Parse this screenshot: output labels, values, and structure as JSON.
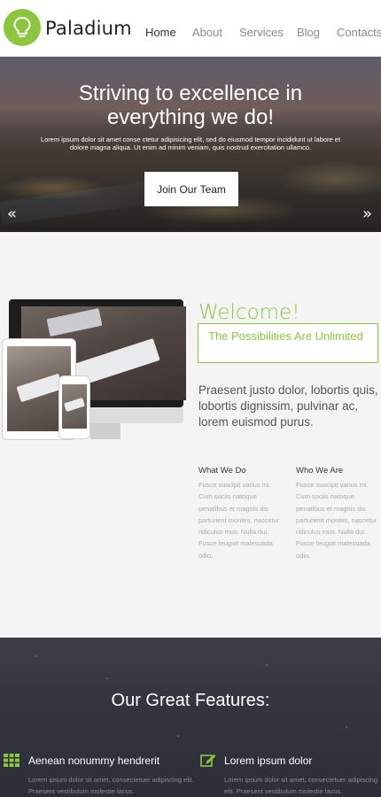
{
  "header": {
    "brand": "Paladium",
    "nav": [
      "Home",
      "About",
      "Services",
      "Blog",
      "Contacts"
    ],
    "active_nav": "Home",
    "icons": {
      "logo": "lightbulb-icon"
    }
  },
  "hero": {
    "title_line1": "Striving to excellence in",
    "title_line2": "everything we do!",
    "text": "Lorem ipsum dolor sit amet conse ctetur adipisicing elit, sed do eiusmod tempor incididunt ut labore et dolore magna aliqua. Ut enim ad minim veniam, quis nostrud exercitation ullamco.",
    "button": "Join Our Team",
    "prev_arrow": "«",
    "next_arrow": "»"
  },
  "welcome": {
    "heading": "Welcome!",
    "tagline": "The Possibilities Are Unlimited",
    "intro": "Praesent justo dolor, lobortis quis, lobortis dignissim, pulvinar ac, lorem euismod purus.",
    "columns": [
      {
        "title": "What We Do",
        "text": "Fusce suscipit varius mi. Cum sociis natoque penatibus et magnis dis parturient montes, nascetur ridiculus mus. Nulla dui. Fusce feugiat malesuada odio."
      },
      {
        "title": "Who We Are",
        "text": "Fusce suscipit varius mi. Cum sociis natoque penatibus et magnis dis parturient montes, nascetur ridiculus mus. Nulla dui. Fusce feugiat malesuada odio."
      }
    ]
  },
  "features": {
    "title": "Our Great Features:",
    "items": [
      {
        "icon": "grid-icon",
        "title": "Aenean nonummy hendrerit",
        "text": "Lorem ipsum dolor sit amet, consectetuer adipiscing elit. Praesent vestibulum molestie lacus."
      },
      {
        "icon": "edit-icon",
        "title": "Lorem ipsum dolor",
        "text": "Lorem ipsum dolor sit amet, consectetuer adipiscing elit. Praesent vestibulum molestie lacus."
      }
    ]
  },
  "colors": {
    "accent": "#8cc63f",
    "dark": "#33353f"
  }
}
